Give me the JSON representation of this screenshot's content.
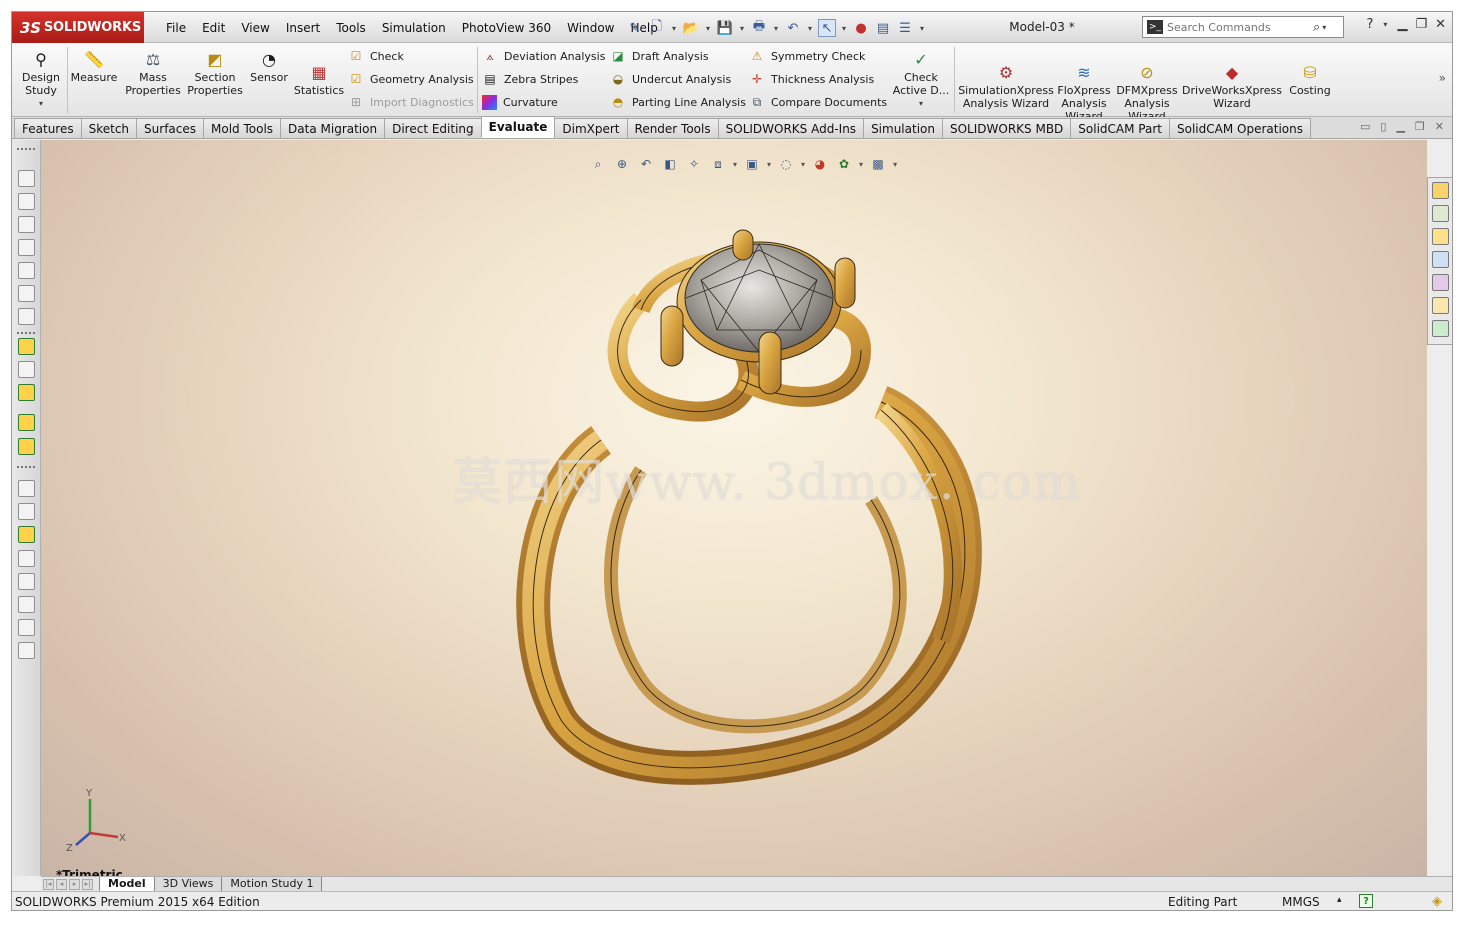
{
  "app": {
    "brand": "SOLIDWORKS",
    "brand_prefix": "3S",
    "doc_title": "Model-03 *"
  },
  "menu": [
    "File",
    "Edit",
    "View",
    "Insert",
    "Tools",
    "Simulation",
    "PhotoView 360",
    "Window",
    "Help"
  ],
  "search": {
    "placeholder": "Search Commands"
  },
  "ribbon": {
    "design_study": "Design Study",
    "measure": "Measure",
    "mass_properties": "Mass Properties",
    "section_properties": "Section Properties",
    "sensor": "Sensor",
    "statistics": "Statistics",
    "check": "Check",
    "geometry_analysis": "Geometry Analysis",
    "import_diagnostics": "Import Diagnostics",
    "deviation_analysis": "Deviation Analysis",
    "zebra_stripes": "Zebra Stripes",
    "curvature": "Curvature",
    "draft_analysis": "Draft Analysis",
    "undercut_analysis": "Undercut Analysis",
    "parting_line_analysis": "Parting Line Analysis",
    "symmetry_check": "Symmetry Check",
    "thickness_analysis": "Thickness Analysis",
    "compare_documents": "Compare Documents",
    "check_active": "Check Active D...",
    "simxpress": "SimulationXpress Analysis Wizard",
    "floxpress": "FloXpress Analysis Wizard",
    "dfmxpress": "DFMXpress Analysis Wizard",
    "driveworks": "DriveWorksXpress Wizard",
    "costing": "Costing"
  },
  "tabs": [
    "Features",
    "Sketch",
    "Surfaces",
    "Mold Tools",
    "Data Migration",
    "Direct Editing",
    "Evaluate",
    "DimXpert",
    "Render Tools",
    "SOLIDWORKS Add-Ins",
    "Simulation",
    "SOLIDWORKS MBD",
    "SolidCAM Part",
    "SolidCAM Operations"
  ],
  "active_tab": "Evaluate",
  "viewport": {
    "watermark": "莫西网www. 3dmox. com",
    "view_name": "*Trimetric",
    "triad": {
      "x": "X",
      "y": "Y",
      "z": "Z"
    }
  },
  "bottom_tabs": [
    "Model",
    "3D Views",
    "Motion Study 1"
  ],
  "status": {
    "product": "SOLIDWORKS Premium 2015 x64 Edition",
    "mode": "Editing Part",
    "units": "MMGS",
    "help_glyph": "?"
  },
  "colors": {
    "brand_red": "#c8281f",
    "gold": "#d9a441",
    "viewport_light": "#fbf5e6",
    "viewport_dark": "#cab4a6"
  }
}
